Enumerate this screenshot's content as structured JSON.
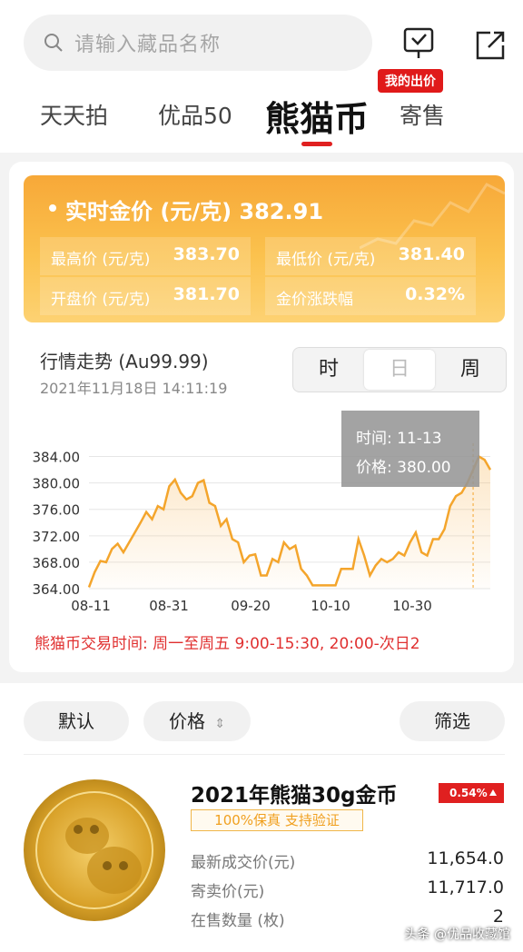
{
  "search": {
    "placeholder": "请输入藏品名称"
  },
  "header": {
    "bid_badge": "我的出价"
  },
  "tabs": [
    "天天拍",
    "优品50",
    "熊猫币",
    "寄售"
  ],
  "gold": {
    "title": "实时金价 (元/克) 382.91",
    "stats": [
      {
        "label": "最高价 (元/克)",
        "value": "383.70"
      },
      {
        "label": "最低价 (元/克)",
        "value": "381.40"
      },
      {
        "label": "开盘价 (元/克)",
        "value": "381.70"
      },
      {
        "label": "金价涨跌幅",
        "value": "0.32%"
      }
    ]
  },
  "trend": {
    "title": "行情走势 (Au99.99)",
    "datetime": "2021年11月18日 14:11:19",
    "segments": [
      "时",
      "日",
      "周"
    ]
  },
  "tooltip": {
    "date": "时间: 11-13",
    "price": "价格: 380.00"
  },
  "chart_data": {
    "type": "line",
    "ylim": [
      364,
      386
    ],
    "yticks": [
      "384.00",
      "380.00",
      "376.00",
      "372.00",
      "368.00",
      "364.00"
    ],
    "xticks": [
      "08-11",
      "08-31",
      "09-20",
      "10-10",
      "10-30"
    ],
    "series": [
      {
        "values": [
          364.2,
          366.5,
          368.2,
          368.0,
          370.0,
          370.8,
          369.5,
          371.0,
          372.5,
          374.0,
          375.6,
          374.5,
          376.5,
          376.0,
          379.5,
          380.5,
          378.5,
          377.5,
          378.0,
          380.0,
          380.4,
          377.0,
          376.5,
          373.5,
          374.5,
          371.5,
          371.0,
          368.0,
          369.0,
          369.2,
          366.0,
          366.0,
          368.5,
          368.0,
          371.0,
          370.0,
          370.5,
          367.0,
          366.0,
          364.5,
          364.5,
          364.5,
          364.5,
          364.5,
          367.0,
          367.0,
          367.0,
          371.5,
          369.0,
          366.0,
          367.5,
          368.5,
          368.0,
          368.5,
          369.5,
          369.0,
          371.0,
          372.5,
          369.5,
          369.0,
          371.5,
          371.5,
          373.0,
          376.5,
          378.0,
          378.5,
          380.0,
          382.0,
          384.0,
          383.5,
          382.0
        ]
      }
    ]
  },
  "trading_hours": "熊猫币交易时间: 周一至周五 9:00-15:30, 20:00-次日2",
  "filters": {
    "default": "默认",
    "price": "价格",
    "price_icon": "⇕",
    "filter": "筛选"
  },
  "product": {
    "title": "2021年熊猫30g金币",
    "change_badge": "0.54%",
    "guarantee": "100%保真 支持验证",
    "rows": [
      {
        "label": "最新成交价(元)",
        "value": "11,654.0"
      },
      {
        "label": "寄卖价(元)",
        "value": "11,717.0"
      },
      {
        "label": "在售数量 (枚)",
        "value": "2"
      }
    ]
  },
  "watermark": "头条 @优品收藏馆"
}
